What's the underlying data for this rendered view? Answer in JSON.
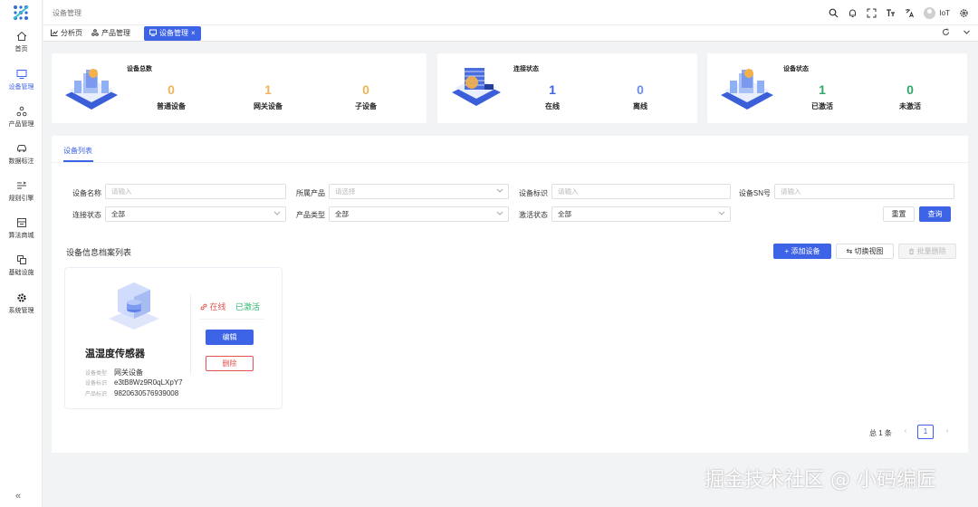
{
  "sidebar": {
    "items": [
      {
        "label": "首页",
        "icon": "home-icon"
      },
      {
        "label": "设备管理",
        "icon": "monitor-icon",
        "active": true
      },
      {
        "label": "产品管理",
        "icon": "product-icon"
      },
      {
        "label": "数据标注",
        "icon": "car-icon"
      },
      {
        "label": "规则引擎",
        "icon": "rule-icon"
      },
      {
        "label": "算法商城",
        "icon": "store-icon"
      },
      {
        "label": "基础设施",
        "icon": "infra-icon"
      },
      {
        "label": "系统管理",
        "icon": "gear-icon"
      }
    ],
    "collapse": "«"
  },
  "topbar": {
    "breadcrumb": "设备管理",
    "user": "IoT"
  },
  "tabs": [
    {
      "label": "分析页",
      "icon": "chart-icon"
    },
    {
      "label": "产品管理",
      "icon": "product-icon"
    },
    {
      "label": "设备管理",
      "icon": "monitor-icon",
      "active": true,
      "close": "×"
    }
  ],
  "stats": {
    "total": {
      "title": "设备总数",
      "items": [
        {
          "value": "0",
          "label": "普通设备",
          "color": "#f0b45a"
        },
        {
          "value": "1",
          "label": "网关设备",
          "color": "#f0b45a"
        },
        {
          "value": "0",
          "label": "子设备",
          "color": "#f0b45a"
        }
      ]
    },
    "connection": {
      "title": "连接状态",
      "items": [
        {
          "value": "1",
          "label": "在线",
          "color": "#3d63e6"
        },
        {
          "value": "0",
          "label": "离线",
          "color": "#6f8fe6"
        }
      ]
    },
    "device": {
      "title": "设备状态",
      "items": [
        {
          "value": "1",
          "label": "已激活",
          "color": "#2fa866"
        },
        {
          "value": "0",
          "label": "未激活",
          "color": "#2fa866"
        }
      ]
    }
  },
  "panel": {
    "tab": "设备列表",
    "filters": {
      "device_name": {
        "label": "设备名称",
        "placeholder": "请输入"
      },
      "product": {
        "label": "所属产品",
        "placeholder": "请选择"
      },
      "device_id": {
        "label": "设备标识",
        "placeholder": "请输入"
      },
      "sn": {
        "label": "设备SN号",
        "placeholder": "请输入"
      },
      "conn_state": {
        "label": "连接状态",
        "value": "全部"
      },
      "product_type": {
        "label": "产品类型",
        "value": "全部"
      },
      "active_state": {
        "label": "激活状态",
        "value": "全部"
      }
    },
    "reset": "重置",
    "query": "查询",
    "section_title": "设备信息档案列表",
    "add": "+ 添加设备",
    "switch": "⇆ 切换视图",
    "batch_delete": "批量删除"
  },
  "device_card": {
    "name": "温湿度传感器",
    "online": "在线",
    "activated": "已激活",
    "edit": "编辑",
    "delete": "删除",
    "rows": [
      {
        "key": "设备类型",
        "value": "网关设备"
      },
      {
        "key": "设备标识",
        "value": "e3tB8Wz9R0qLXpY7"
      },
      {
        "key": "产品标识",
        "value": "9820630576939008"
      }
    ]
  },
  "pagination": {
    "total": "总 1 条",
    "current": "1",
    "prev": "‹",
    "next": "›"
  },
  "watermark": "掘金技术社区 @ 小码编匠"
}
